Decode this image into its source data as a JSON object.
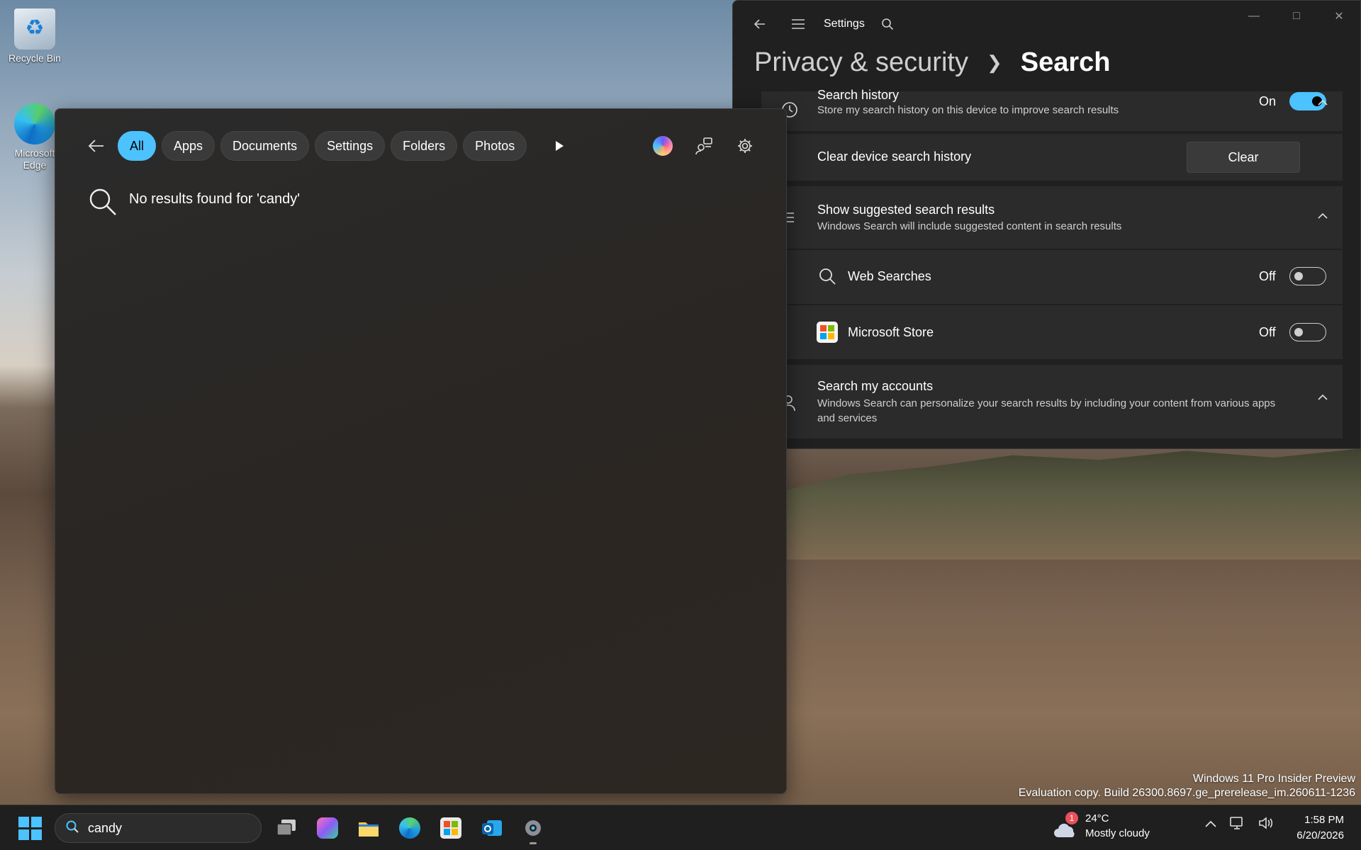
{
  "desktop": {
    "icons": [
      {
        "label": "Recycle Bin"
      },
      {
        "label": "Microsoft Edge"
      }
    ]
  },
  "search_flyout": {
    "filters": [
      "All",
      "Apps",
      "Documents",
      "Settings",
      "Folders",
      "Photos"
    ],
    "active_filter": "All",
    "no_results_text": "No results found for 'candy'"
  },
  "settings": {
    "window_title": "Settings",
    "breadcrumb": {
      "parent": "Privacy & security",
      "current": "Search"
    },
    "search_history": {
      "title": "Search history",
      "subtitle": "Store my search history on this device to improve search results",
      "state": "On"
    },
    "clear_history": {
      "title": "Clear device search history",
      "button": "Clear"
    },
    "suggested": {
      "title": "Show suggested search results",
      "subtitle": "Windows Search will include suggested content in search results"
    },
    "web_searches": {
      "title": "Web Searches",
      "state": "Off"
    },
    "microsoft_store": {
      "title": "Microsoft Store",
      "state": "Off"
    },
    "accounts": {
      "title": "Search my accounts",
      "subtitle": "Windows Search can personalize your search results by including your content from various apps and services"
    }
  },
  "watermark": {
    "line1": "Windows 11 Pro Insider Preview",
    "line2": "Evaluation copy. Build 26300.8697.ge_prerelease_im.260611-1236"
  },
  "taskbar": {
    "search_query": "candy",
    "weather": {
      "temp": "24°C",
      "condition": "Mostly cloudy",
      "badge": "1"
    },
    "clock": {
      "time": "1:58 PM",
      "date": "6/20/2026"
    }
  },
  "colors": {
    "accent": "#4cc2ff",
    "window_bg": "#202020",
    "card_bg": "#2b2b2b"
  }
}
